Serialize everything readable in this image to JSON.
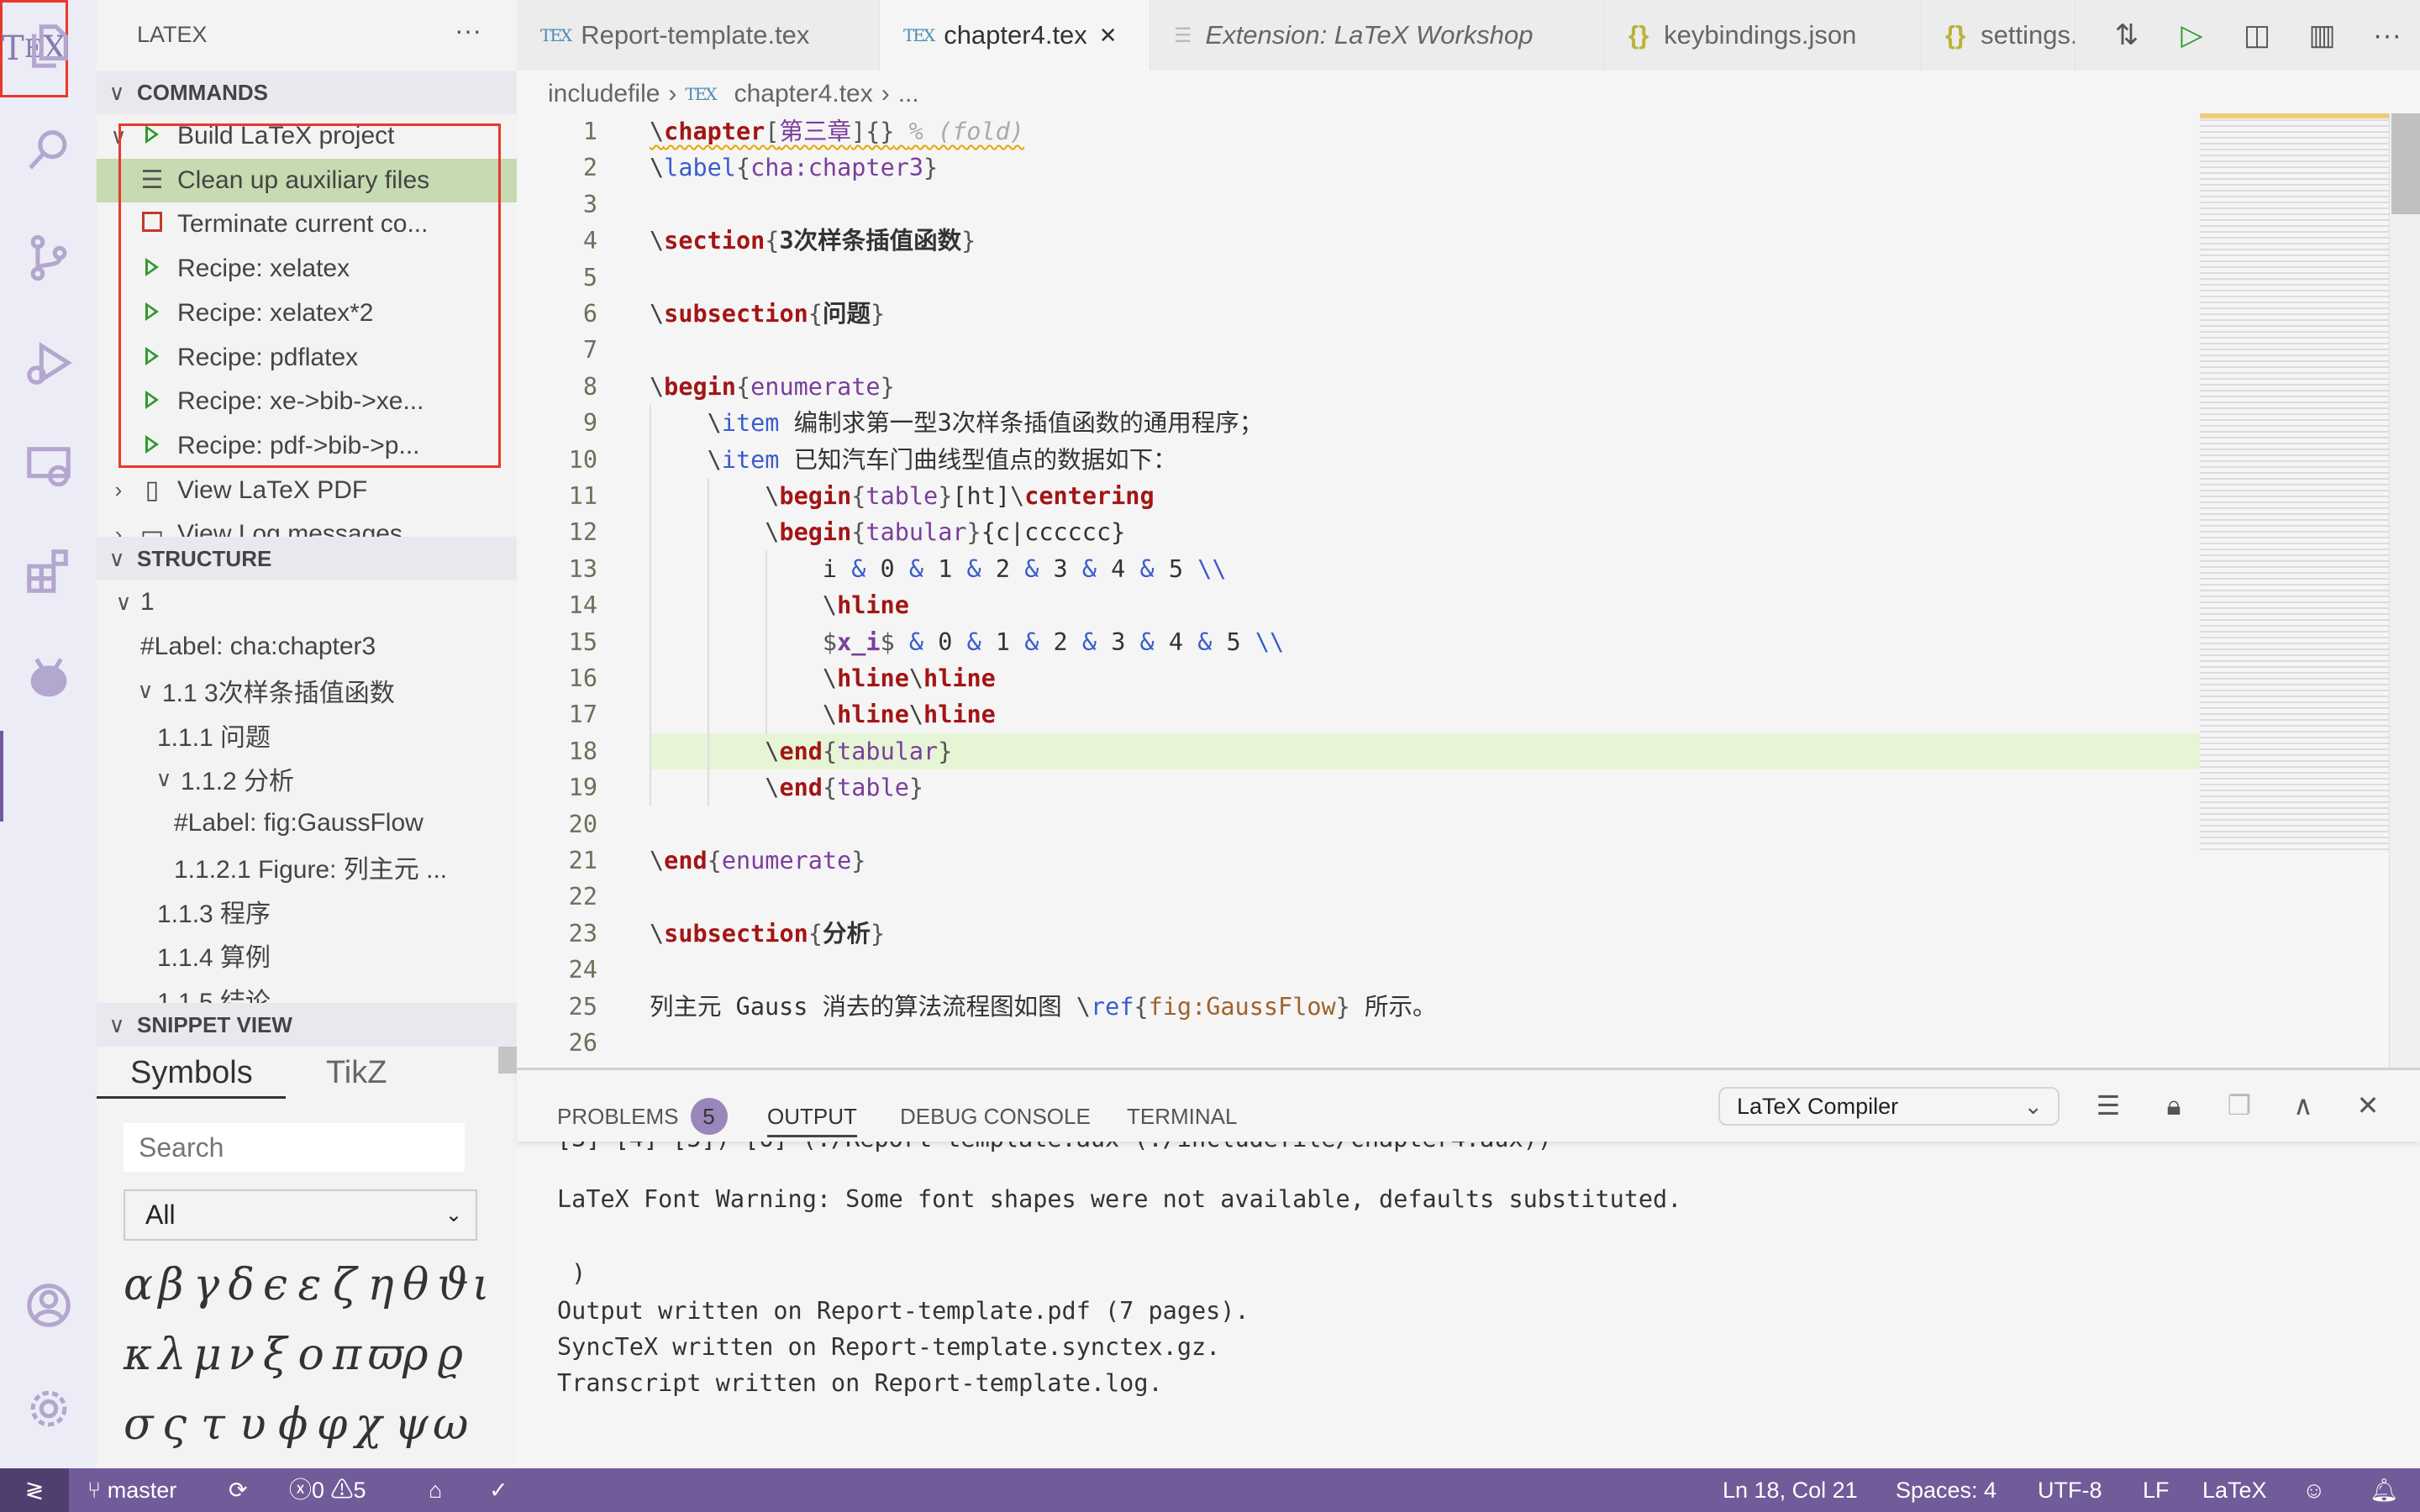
{
  "activity_bar": {
    "items": [
      {
        "name": "explorer",
        "icon": "files-icon"
      },
      {
        "name": "search",
        "icon": "search-icon"
      },
      {
        "name": "source-control",
        "icon": "source-control-icon"
      },
      {
        "name": "run-debug",
        "icon": "debug-icon"
      },
      {
        "name": "remote-explorer",
        "icon": "remote-explorer-icon"
      },
      {
        "name": "extensions",
        "icon": "extensions-icon"
      },
      {
        "name": "alien",
        "icon": "alien-icon"
      }
    ],
    "tex_label": "TEX",
    "account_icon": "account-icon",
    "settings_icon": "gear-icon"
  },
  "sidebar": {
    "title": "LATEX",
    "more": "···",
    "commands": {
      "header": "COMMANDS",
      "items": [
        {
          "label": "Build LaTeX project",
          "icon": "play-icon",
          "twisty": "v"
        },
        {
          "label": "Clean up auxiliary files",
          "icon": "clear-icon",
          "selected": true
        },
        {
          "label": "Terminate current co...",
          "icon": "stop-icon"
        },
        {
          "label": "Recipe: xelatex",
          "icon": "play-icon"
        },
        {
          "label": "Recipe: xelatex*2",
          "icon": "play-icon"
        },
        {
          "label": "Recipe: pdflatex",
          "icon": "play-icon"
        },
        {
          "label": "Recipe: xe->bib->xe...",
          "icon": "play-icon"
        },
        {
          "label": "Recipe: pdf->bib->p...",
          "icon": "play-icon"
        },
        {
          "label": "View LaTeX PDF",
          "icon": "preview-icon",
          "twisty": ">"
        },
        {
          "label": "View Log messages",
          "icon": "log-icon",
          "twisty": ">"
        }
      ]
    },
    "structure": {
      "header": "STRUCTURE",
      "items": [
        {
          "label": "1",
          "level": 0,
          "twisty": "v"
        },
        {
          "label": "#Label: cha:chapter3",
          "level": 1
        },
        {
          "label": "1.1 3次样条插值函数",
          "level": 1,
          "twisty": "v"
        },
        {
          "label": "1.1.1 问题",
          "level": 2
        },
        {
          "label": "1.1.2 分析",
          "level": 2,
          "twisty": "v"
        },
        {
          "label": "#Label: fig:GaussFlow",
          "level": 3
        },
        {
          "label": "1.1.2.1 Figure:  列主元 ...",
          "level": 3
        },
        {
          "label": "1.1.3 程序",
          "level": 2
        },
        {
          "label": "1.1.4 算例",
          "level": 2
        },
        {
          "label": "1.1.5 结论",
          "level": 2
        }
      ]
    },
    "snippet": {
      "header": "SNIPPET VIEW",
      "tabs": [
        "Symbols",
        "TikZ"
      ],
      "search_placeholder": "Search",
      "filter_value": "All",
      "symbols": [
        [
          "α",
          "β",
          "γ",
          "δ",
          "ϵ",
          "ε",
          "ζ",
          "η",
          "θ",
          "ϑ",
          "ι"
        ],
        [
          "κ",
          "λ",
          "μ",
          "ν",
          "ξ",
          "ο",
          "π",
          "ϖ",
          "ρ",
          "ϱ"
        ],
        [
          "σ",
          "ς",
          "τ",
          "υ",
          "ϕ",
          "φ",
          "χ",
          "ψ",
          "ω"
        ]
      ]
    }
  },
  "tabs": [
    {
      "label": "Report-template.tex",
      "icon": "tex-icon"
    },
    {
      "label": "chapter4.tex",
      "icon": "tex-icon",
      "active": true,
      "close": "✕"
    },
    {
      "label": "Extension: LaTeX Workshop",
      "icon": "extension-icon",
      "italic": true
    },
    {
      "label": "keybindings.json",
      "icon": "json-icon"
    },
    {
      "label": "settings.json",
      "icon": "json-icon"
    }
  ],
  "tab_actions": [
    "compare-changes-icon",
    "run-icon",
    "view-pdf-icon",
    "split-editor-icon",
    "more-icon"
  ],
  "breadcrumb": [
    "includefile",
    "chapter4.tex",
    "..."
  ],
  "editor": {
    "current_line": 18,
    "lines": [
      [
        [
          "bs",
          "\\"
        ],
        [
          "cmd",
          "chapter"
        ],
        [
          "br",
          "["
        ],
        [
          "arg",
          "第三章"
        ],
        [
          "br",
          "]{}"
        ],
        [
          "txt",
          " "
        ],
        [
          "cmt",
          "% (fold)"
        ]
      ],
      [
        [
          "bs",
          "\\"
        ],
        [
          "kw",
          "label"
        ],
        [
          "br",
          "{"
        ],
        [
          "arg",
          "cha:chapter3"
        ],
        [
          "br",
          "}"
        ]
      ],
      [],
      [
        [
          "bs",
          "\\"
        ],
        [
          "cmd",
          "section"
        ],
        [
          "br",
          "{"
        ],
        [
          "bold",
          "3次样条插值函数"
        ],
        [
          "br",
          "}"
        ]
      ],
      [],
      [
        [
          "bs",
          "\\"
        ],
        [
          "cmd",
          "subsection"
        ],
        [
          "br",
          "{"
        ],
        [
          "bold",
          "问题"
        ],
        [
          "br",
          "}"
        ]
      ],
      [],
      [
        [
          "bs",
          "\\"
        ],
        [
          "cmd",
          "begin"
        ],
        [
          "br",
          "{"
        ],
        [
          "arg",
          "enumerate"
        ],
        [
          "br",
          "}"
        ]
      ],
      [
        [
          "txt",
          "    "
        ],
        [
          "bs",
          "\\"
        ],
        [
          "kw",
          "item"
        ],
        [
          "txt",
          " 编制求第一型3次样条插值函数的通用程序；"
        ]
      ],
      [
        [
          "txt",
          "    "
        ],
        [
          "bs",
          "\\"
        ],
        [
          "kw",
          "item"
        ],
        [
          "txt",
          " 已知汽车门曲线型值点的数据如下："
        ]
      ],
      [
        [
          "txt",
          "        "
        ],
        [
          "bs",
          "\\"
        ],
        [
          "cmd",
          "begin"
        ],
        [
          "br",
          "{"
        ],
        [
          "arg",
          "table"
        ],
        [
          "br",
          "}"
        ],
        [
          "txt",
          "[ht]"
        ],
        [
          "bs",
          "\\"
        ],
        [
          "cmd",
          "centering"
        ]
      ],
      [
        [
          "txt",
          "        "
        ],
        [
          "bs",
          "\\"
        ],
        [
          "cmd",
          "begin"
        ],
        [
          "br",
          "{"
        ],
        [
          "arg",
          "tabular"
        ],
        [
          "br",
          "}"
        ],
        [
          "txt",
          "{c|cccccc}"
        ]
      ],
      [
        [
          "txt",
          "            i "
        ],
        [
          "kw",
          "&"
        ],
        [
          "txt",
          " 0 "
        ],
        [
          "kw",
          "&"
        ],
        [
          "txt",
          " 1 "
        ],
        [
          "kw",
          "&"
        ],
        [
          "txt",
          " 2 "
        ],
        [
          "kw",
          "&"
        ],
        [
          "txt",
          " 3 "
        ],
        [
          "kw",
          "&"
        ],
        [
          "txt",
          " 4 "
        ],
        [
          "kw",
          "&"
        ],
        [
          "txt",
          " 5 "
        ],
        [
          "kw",
          "\\\\"
        ]
      ],
      [
        [
          "txt",
          "            "
        ],
        [
          "bs",
          "\\"
        ],
        [
          "cmd",
          "hline"
        ]
      ],
      [
        [
          "txt",
          "            "
        ],
        [
          "br",
          "$"
        ],
        [
          "math",
          "x_i"
        ],
        [
          "br",
          "$"
        ],
        [
          "txt",
          " "
        ],
        [
          "kw",
          "&"
        ],
        [
          "txt",
          " 0 "
        ],
        [
          "kw",
          "&"
        ],
        [
          "txt",
          " 1 "
        ],
        [
          "kw",
          "&"
        ],
        [
          "txt",
          " 2 "
        ],
        [
          "kw",
          "&"
        ],
        [
          "txt",
          " 3 "
        ],
        [
          "kw",
          "&"
        ],
        [
          "txt",
          " 4 "
        ],
        [
          "kw",
          "&"
        ],
        [
          "txt",
          " 5 "
        ],
        [
          "kw",
          "\\\\"
        ]
      ],
      [
        [
          "txt",
          "            "
        ],
        [
          "bs",
          "\\"
        ],
        [
          "cmd",
          "hline"
        ],
        [
          "bs",
          "\\"
        ],
        [
          "cmd",
          "hline"
        ]
      ],
      [
        [
          "txt",
          "            "
        ],
        [
          "bs",
          "\\"
        ],
        [
          "cmd",
          "hline"
        ],
        [
          "bs",
          "\\"
        ],
        [
          "cmd",
          "hline"
        ]
      ],
      [
        [
          "txt",
          "        "
        ],
        [
          "bs",
          "\\"
        ],
        [
          "cmd",
          "end"
        ],
        [
          "br",
          "{"
        ],
        [
          "arg",
          "tabular"
        ],
        [
          "br",
          "}"
        ]
      ],
      [
        [
          "txt",
          "        "
        ],
        [
          "bs",
          "\\"
        ],
        [
          "cmd",
          "end"
        ],
        [
          "br",
          "{"
        ],
        [
          "arg",
          "table"
        ],
        [
          "br",
          "}"
        ]
      ],
      [],
      [
        [
          "bs",
          "\\"
        ],
        [
          "cmd",
          "end"
        ],
        [
          "br",
          "{"
        ],
        [
          "arg",
          "enumerate"
        ],
        [
          "br",
          "}"
        ]
      ],
      [],
      [
        [
          "bs",
          "\\"
        ],
        [
          "cmd",
          "subsection"
        ],
        [
          "br",
          "{"
        ],
        [
          "bold",
          "分析"
        ],
        [
          "br",
          "}"
        ]
      ],
      [],
      [
        [
          "txt",
          "列主元 Gauss 消去的算法流程图如图 "
        ],
        [
          "bs",
          "\\"
        ],
        [
          "kw",
          "ref"
        ],
        [
          "br",
          "{"
        ],
        [
          "ref",
          "fig:GaussFlow"
        ],
        [
          "br",
          "}"
        ],
        [
          "txt",
          " 所示。"
        ]
      ],
      [],
      [
        [
          "txt",
          "    "
        ],
        [
          "bs",
          "\\"
        ],
        [
          "cmd",
          "begin"
        ],
        [
          "br",
          "{"
        ],
        [
          "arg",
          "figure"
        ],
        [
          "br",
          "}"
        ],
        [
          "txt",
          "[H]"
        ]
      ]
    ]
  },
  "panel": {
    "tabs": [
      {
        "label": "PROBLEMS",
        "badge": "5"
      },
      {
        "label": "OUTPUT",
        "active": true
      },
      {
        "label": "DEBUG CONSOLE"
      },
      {
        "label": "TERMINAL"
      }
    ],
    "channel": "LaTeX Compiler",
    "actions": [
      "clear-output-icon",
      "lock-scroll-icon",
      "open-log-icon",
      "maximize-panel-icon",
      "close-panel-icon"
    ],
    "output": [
      "[3] [4] [5]) [6] (./Report-template.aux (./includefile/chapter4.aux))",
      "",
      "LaTeX Font Warning: Some font shapes were not available, defaults substituted.",
      "",
      " )",
      "Output written on Report-template.pdf (7 pages).",
      "SyncTeX written on Report-template.synctex.gz.",
      "Transcript written on Report-template.log."
    ]
  },
  "status_bar": {
    "branch": "master",
    "errors": "0",
    "warnings": "5",
    "position": "Ln 18, Col 21",
    "spaces": "Spaces: 4",
    "encoding": "UTF-8",
    "eol": "LF",
    "language": "LaTeX",
    "color": "#725b99"
  }
}
